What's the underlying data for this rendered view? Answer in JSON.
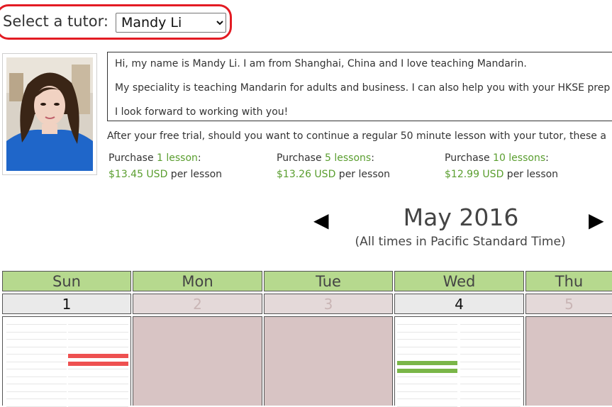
{
  "tutor_select": {
    "label": "Select a tutor:",
    "selected": "Mandy Li"
  },
  "bio": {
    "line1": "Hi, my name is Mandy Li. I am from Shanghai, China and I love teaching Mandarin.",
    "line2": "My speciality is teaching Mandarin for adults and business. I can also help you with your HKSE prep",
    "line3": "I look forward to working with you!"
  },
  "after_trial_text": "After your free trial, should you want to continue a regular 50 minute lesson with your tutor, these a",
  "purchases": [
    {
      "prefix": "Purchase ",
      "link": "1 lesson",
      "suffix": ":",
      "price": "$13.45 USD",
      "per": " per lesson"
    },
    {
      "prefix": "Purchase ",
      "link": "5 lessons",
      "suffix": ":",
      "price": "$13.26 USD",
      "per": " per lesson"
    },
    {
      "prefix": "Purchase ",
      "link": "10 lessons",
      "suffix": ":",
      "price": "$12.99 USD",
      "per": " per lesson"
    }
  ],
  "calendar": {
    "prev_arrow": "◀",
    "next_arrow": "▶",
    "month_title": "May 2016",
    "timezone_note": "(All times in Pacific Standard Time)",
    "days": [
      {
        "name": "Sun",
        "date": "1",
        "available": true
      },
      {
        "name": "Mon",
        "date": "2",
        "available": false
      },
      {
        "name": "Tue",
        "date": "3",
        "available": false
      },
      {
        "name": "Wed",
        "date": "4",
        "available": true
      },
      {
        "name": "Thu",
        "date": "5",
        "available": false
      }
    ]
  },
  "colors": {
    "highlight": "#e31b23",
    "day_header": "#b6d98e",
    "unavailable_cell": "#d8c4c4",
    "booked_slot": "#ee5050",
    "open_slot": "#7ab648",
    "link_green": "#5a9e2f"
  }
}
